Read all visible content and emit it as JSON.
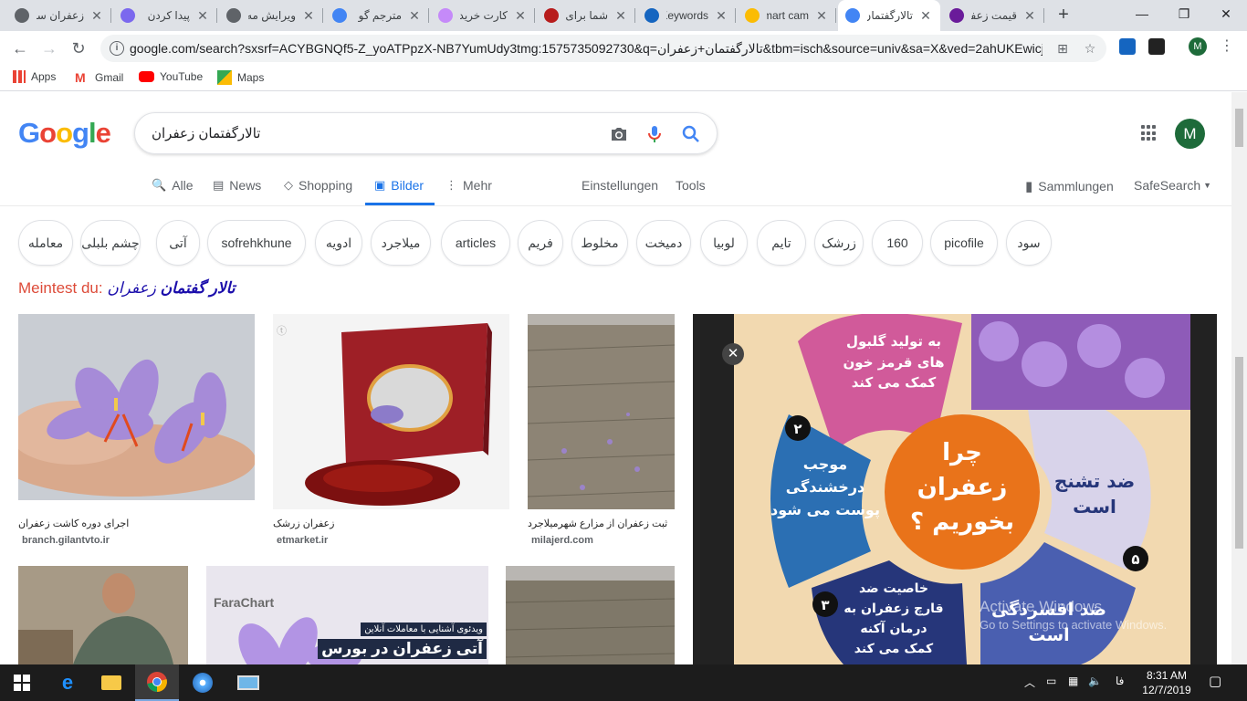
{
  "browser": {
    "tabs": [
      {
        "title": "زعفران سر",
        "fav_color": "#5f6368"
      },
      {
        "title": "پیدا کردن",
        "fav_color": "#7b68ee"
      },
      {
        "title": "ویرایش مه",
        "fav_color": "#5f6368"
      },
      {
        "title": "مترجم گو",
        "fav_color": "#4285f4"
      },
      {
        "title": "کارت خرید",
        "fav_color": "#c58af9"
      },
      {
        "title": "شما برای",
        "fav_color": "#b71c1c"
      },
      {
        "title": "Keywords",
        "fav_color": "#1565c0"
      },
      {
        "title": "Smart cam",
        "fav_color": "#fbbc04"
      },
      {
        "title": "تالارگفتمان",
        "fav_color": "#4285f4",
        "active": true
      },
      {
        "title": "قیمت زعفر",
        "fav_color": "#6a1b9a"
      }
    ],
    "tab_close": "✕",
    "new_tab": "+",
    "window_controls": {
      "minimize": "—",
      "maximize": "❐",
      "close": "✕"
    },
    "nav": {
      "back": "←",
      "forward": "→",
      "reload": "↻"
    },
    "url": "google.com/search?sxsrf=ACYBGNQf5-Z_yoATPpzX-NB7YumUdy3tmg:1575735092730&q=تالارگفتمان+زعفران&tbm=isch&source=univ&sa=X&ved=2ahUKEwicj...",
    "profile_initial": "M",
    "bookmarks": [
      {
        "label": "Apps",
        "icon": "apps-icon"
      },
      {
        "label": "Gmail",
        "icon": "gmail-icon"
      },
      {
        "label": "YouTube",
        "icon": "youtube-icon"
      },
      {
        "label": "Maps",
        "icon": "maps-icon"
      }
    ]
  },
  "google": {
    "logo": [
      "G",
      "o",
      "o",
      "g",
      "l",
      "e"
    ],
    "logo_colors": [
      "#4285f4",
      "#ea4335",
      "#fbbc05",
      "#4285f4",
      "#34a853",
      "#ea4335"
    ],
    "query": "تالارگفتمان زعفران",
    "avatar_initial": "M",
    "tabs": [
      {
        "label": "Alle",
        "icon": "🔍"
      },
      {
        "label": "News",
        "icon": "▤"
      },
      {
        "label": "Shopping",
        "icon": "◇"
      },
      {
        "label": "Bilder",
        "icon": "▣",
        "selected": true
      },
      {
        "label": "Mehr",
        "icon": "⋮"
      }
    ],
    "settings_label": "Einstellungen",
    "tools_label": "Tools",
    "collections_label": "Sammlungen",
    "safesearch_label": "SafeSearch",
    "chips": [
      "معامله",
      "چشم بلبلی",
      "آتی",
      "sofrehkhune",
      "ادویه",
      "میلاجرد",
      "articles",
      "فریم",
      "مخلوط",
      "دمیخت",
      "لوبیا",
      "تایم",
      "زرشک",
      "160",
      "picofile",
      "سود"
    ],
    "didyoumean_prefix": "Meintest du:",
    "didyoumean_term": "تالار گفتمان",
    "didyoumean_rest": "زعفران",
    "results": [
      {
        "caption": "اجرای دوره کاشت زعفران",
        "domain": "branch.gilantvto.ir"
      },
      {
        "caption": "زعفران زرشک",
        "domain": "etmarket.ir"
      },
      {
        "caption": "ثبت زعفران از مزارع شهرمیلاجرد",
        "domain": "milajerd.com"
      }
    ],
    "row2": {
      "farachart_brand": "FaraChart",
      "farachart_line1": "ویدئوی آشنایی با معاملات آنلاین",
      "farachart_line2": "آتی زعفران در بورس"
    },
    "preview": {
      "close": "✕",
      "center_text": [
        "چرا",
        "زعفران",
        "بخوریم ؟"
      ],
      "petal_top": [
        "به تولید گلبول",
        "های قرمز خون",
        "کمک می کند"
      ],
      "petal_left": [
        "موجب",
        "درخشندگی",
        "پوست می شود"
      ],
      "petal_right": [
        "ضد تشنج",
        "است"
      ],
      "petal_bottom_left": [
        "خاصیت ضد",
        "قارچ زعفران به",
        "درمان آکنه",
        "کمک می کند"
      ],
      "petal_bottom_right": [
        "ضد افسردگی",
        "است"
      ],
      "num_left": "۲",
      "num_right": "۵",
      "num_bottom": "۳"
    },
    "watermark_line1": "Activate Windows",
    "watermark_line2": "Go to Settings to activate Windows."
  },
  "taskbar": {
    "time": "8:31 AM",
    "date": "12/7/2019",
    "lang": "فا"
  }
}
